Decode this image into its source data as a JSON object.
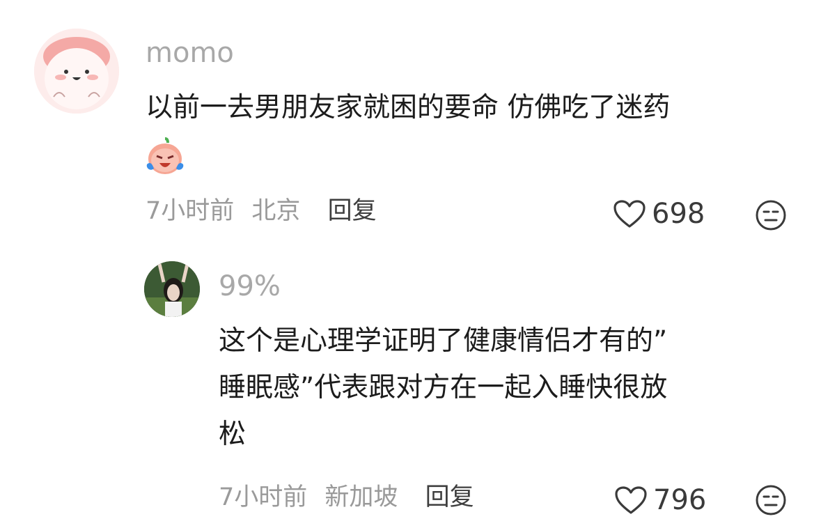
{
  "comment": {
    "username": "momo",
    "text_lines": [
      "以前一去男朋友家就困的要命 仿佛吃了迷药"
    ],
    "emoji": "crying-laughing-sticker",
    "time": "7小时前",
    "location": "北京",
    "reply_label": "回复",
    "likes": "698"
  },
  "reply": {
    "username": "99%",
    "text_lines": [
      "这个是心理学证明了健康情侣才有的”",
      "睡眠感”代表跟对方在一起入睡快很放",
      "松"
    ],
    "time": "7小时前",
    "location": "新加坡",
    "reply_label": "回复",
    "likes": "796"
  },
  "icons": {
    "like": "heart-outline-icon",
    "dislike": "neutral-face-icon"
  }
}
